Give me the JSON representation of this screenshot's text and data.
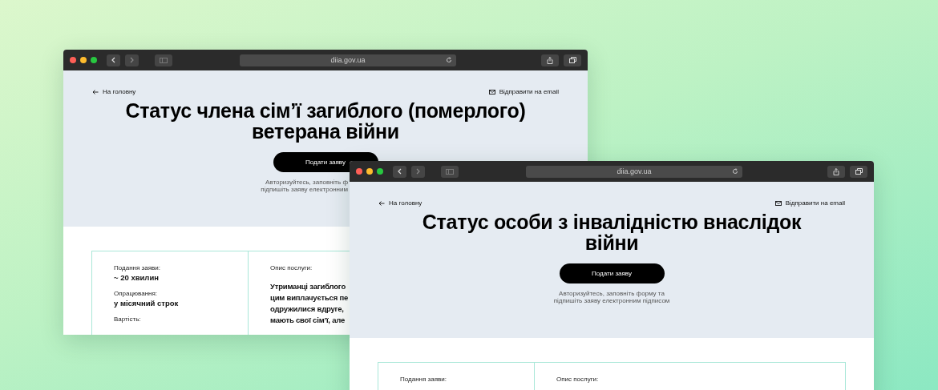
{
  "windows": [
    {
      "url": "diia.gov.ua",
      "back_link": "На головну",
      "email_link": "Відправити на email",
      "title": "Статус члена сім’ї загиблого (померлого) ветерана війни",
      "button": "Подати заяву",
      "hint_lines": [
        "Авторизуйтесь, заповніть ф",
        "підпишіть заяву електронним"
      ],
      "info": [
        {
          "label": "Подання заяви:",
          "value": "~ 20 хвилин"
        },
        {
          "label": "Опрацювання:",
          "value": "у місячний строк"
        },
        {
          "label": "Вартість:"
        }
      ],
      "description_label": "Опис послуги:",
      "description_lines": [
        "Утриманці загиблого",
        "цим виплачується пе",
        "одружилися вдруге,",
        "мають свої сім’ї, але"
      ]
    },
    {
      "url": "diia.gov.ua",
      "back_link": "На головну",
      "email_link": "Відправити на email",
      "title": "Статус особи з інвалідністю внаслідок війни",
      "button": "Подати заяву",
      "hint_lines": [
        "Авторизуйтесь, заповніть форму та",
        "підпишіть заяву електронним підписом"
      ],
      "info": [
        {
          "label": "Подання заяви:"
        }
      ],
      "description_label": "Опис послуги:"
    }
  ]
}
